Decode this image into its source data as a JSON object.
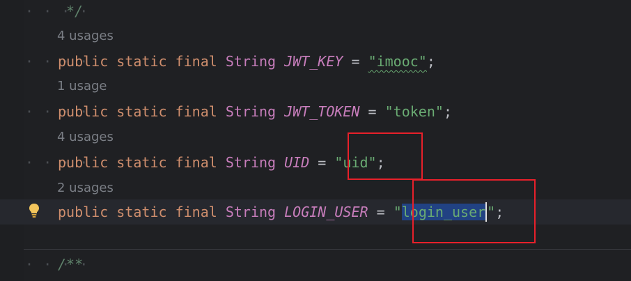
{
  "comment_close": "*/",
  "comment_open": "/**",
  "indent_guide": "· · · ·",
  "fields": [
    {
      "usages": "4 usages",
      "modifiers": "public static final",
      "type": "String",
      "name": "JWT_KEY",
      "assign": "=",
      "value": "\"imooc\"",
      "semicolon": ";"
    },
    {
      "usages": "1 usage",
      "modifiers": "public static final",
      "type": "String",
      "name": "JWT_TOKEN",
      "assign": "=",
      "value": "\"token\"",
      "semicolon": ";"
    },
    {
      "usages": "4 usages",
      "modifiers": "public static final",
      "type": "String",
      "name": "UID",
      "assign": "=",
      "value": "\"uid\"",
      "semicolon": ";"
    },
    {
      "usages": "2 usages",
      "modifiers": "public static final",
      "type": "String",
      "name": "LOGIN_USER",
      "assign": "=",
      "value_open_quote": "\"",
      "value_selected": "login_user",
      "value_close_quote": "\"",
      "semicolon": ";"
    }
  ],
  "colors": {
    "highlight_box": "#e8202a",
    "selection": "#214283",
    "keyword": "#cf8e6d",
    "string": "#6aab73",
    "constant": "#c77dbb"
  },
  "icons": {
    "intention": "lightbulb-icon"
  }
}
